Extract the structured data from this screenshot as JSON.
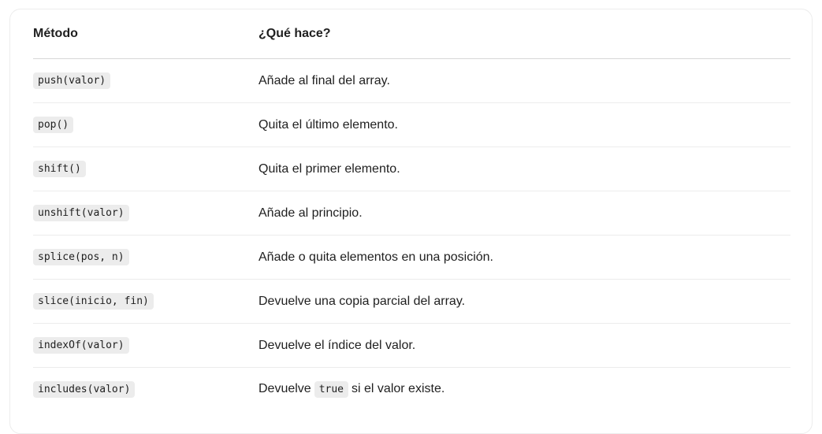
{
  "table": {
    "headers": [
      "Método",
      "¿Qué hace?"
    ],
    "rows": [
      {
        "method": "push(valor)",
        "desc": "Añade al final del array."
      },
      {
        "method": "pop()",
        "desc": "Quita el último elemento."
      },
      {
        "method": "shift()",
        "desc": "Quita el primer elemento."
      },
      {
        "method": "unshift(valor)",
        "desc": "Añade al principio."
      },
      {
        "method": "splice(pos, n)",
        "desc": "Añade o quita elementos en una posición."
      },
      {
        "method": "slice(inicio, fin)",
        "desc": "Devuelve una copia parcial del array."
      },
      {
        "method": "indexOf(valor)",
        "desc": "Devuelve el índice del valor."
      },
      {
        "method": "includes(valor)",
        "desc_before": "Devuelve",
        "desc_code": "true",
        "desc_after": "si el valor existe."
      }
    ]
  }
}
